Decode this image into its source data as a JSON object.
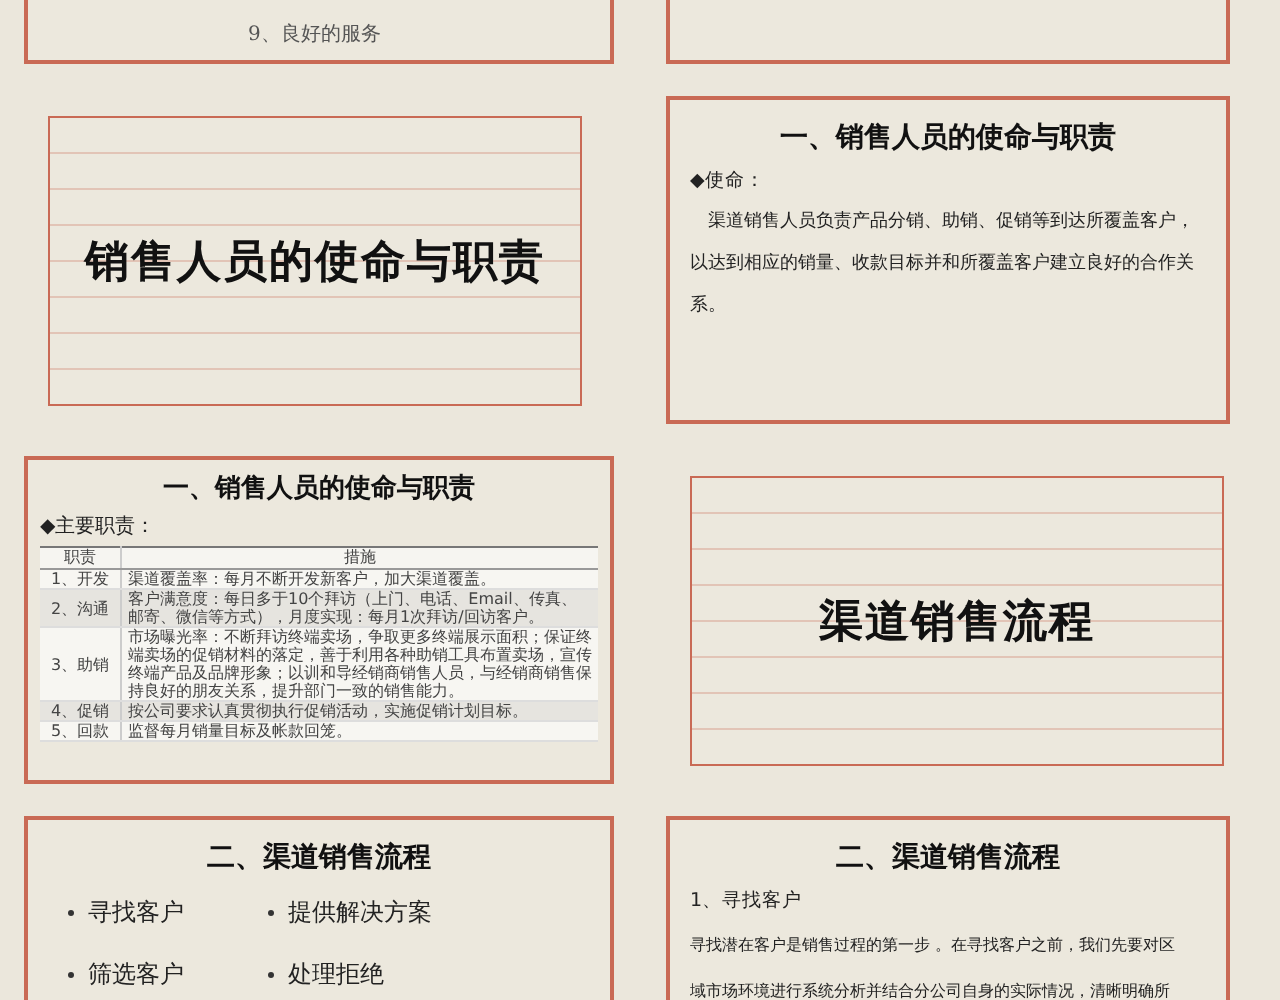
{
  "slides": [
    {
      "kind": "list_tail",
      "items": [
        "9、良好的服务"
      ]
    },
    {
      "kind": "box_tail"
    },
    {
      "kind": "section_title",
      "title": "销售人员的使命与职责"
    },
    {
      "kind": "text",
      "title": "一、销售人员的使命与职责",
      "label": "◆使命：",
      "paragraph": "渠道销售人员负责产品分销、助销、促销等到达所覆盖客户，以达到相应的销量、收款目标并和所覆盖客户建立良好的合作关系。"
    },
    {
      "kind": "table",
      "title": "一、销售人员的使命与职责",
      "label": "◆主要职责：",
      "table": {
        "columns": [
          "职责",
          "措施"
        ],
        "rows": [
          [
            "1、开发",
            "渠道覆盖率：每月不断开发新客户，加大渠道覆盖。"
          ],
          [
            "2、沟通",
            "客户满意度：每日多于10个拜访（上门、电话、Email、传真、邮寄、微信等方式），月度实现：每月1次拜访/回访客户。"
          ],
          [
            "3、助销",
            "市场曝光率：不断拜访终端卖场，争取更多终端展示面积；保证终端卖场的促销材料的落定，善于利用各种助销工具布置卖场，宣传终端产品及品牌形象；以训和导经销商销售人员，与经销商销售保持良好的朋友关系，提升部门一致的销售能力。"
          ],
          [
            "4、促销",
            "按公司要求认真贯彻执行促销活动，实施促销计划目标。"
          ],
          [
            "5、回款",
            "监督每月销量目标及帐款回笼。"
          ]
        ]
      }
    },
    {
      "kind": "section_title",
      "title": "渠道销售流程"
    },
    {
      "kind": "bullets",
      "title": "二、渠道销售流程",
      "bullets": [
        "寻找客户",
        "提供解决方案",
        "筛选客户",
        "处理拒绝"
      ]
    },
    {
      "kind": "lines",
      "title": "二、渠道销售流程",
      "label": "1、寻找客户",
      "lines": [
        "寻找潜在客户是销售过程的第一步 。在寻找客户之前，我们先要对区",
        "域市场环境进行系统分析并结合分公司自身的实际情况，清晰明确所"
      ]
    }
  ]
}
